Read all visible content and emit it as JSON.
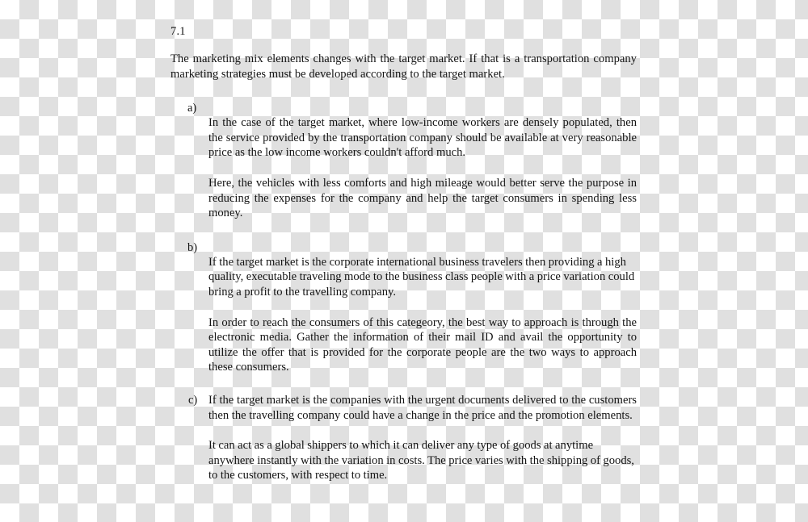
{
  "document": {
    "section_number": "7.1",
    "intro_paragraph": "The marketing mix elements changes with the target market. If that is a transportation company marketing strategies must be developed according to the target market.",
    "items": [
      {
        "marker": "a)",
        "layout": "stacked",
        "paragraphs": [
          "In the case of the target market, where low-income workers are densely populated, then the service provided by the transportation company should be available at very reasonable price as the low income workers couldn't afford much.",
          "Here, the vehicles with less comforts and high mileage would better serve the purpose in reducing the expenses for the company and help the target consumers in spending less money."
        ]
      },
      {
        "marker": "b)",
        "layout": "stacked",
        "paragraphs": [
          "If the target market is the corporate international business travelers then providing a high quality, executable traveling mode to the business class people with a price variation could bring a profit to the travelling company.",
          "In order to reach the consumers of this categeory, the best way to approach is through the electronic media. Gather the information of their mail ID and avail the opportunity to utilize the offer that is provided for the corporate people are the two ways to approach these consumers."
        ]
      },
      {
        "marker": "c)",
        "layout": "inline",
        "paragraphs": [
          "If the target market is the companies with the urgent documents delivered to the customers then the travelling company could have a change in the price and the promotion elements.",
          "It can act as a global shippers to which it can deliver any type of goods at anytime anywhere instantly with the variation in costs. The price varies with the shipping of goods, to the customers, with respect to time."
        ]
      }
    ]
  },
  "appearance": {
    "text_color": "#141414",
    "page_background": "#ffffff",
    "checker_color": "#e0e0e0"
  }
}
